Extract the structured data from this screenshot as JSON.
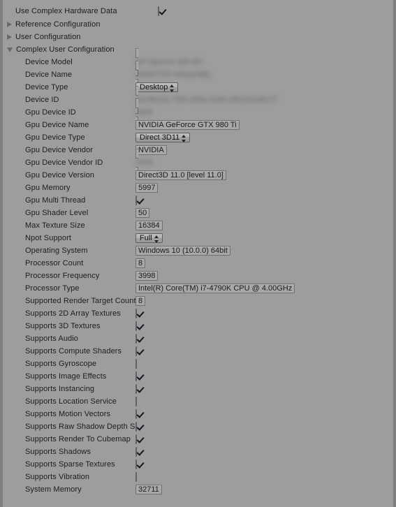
{
  "header": {
    "toggle_label": "Use Complex Hardware Data",
    "toggle_checked": true
  },
  "foldouts": [
    {
      "label": "Reference Configuration",
      "expanded": false
    },
    {
      "label": "User Configuration",
      "expanded": false
    },
    {
      "label": "Complex User Configuration",
      "expanded": true
    }
  ],
  "fields": [
    {
      "label": "Device Model",
      "type": "text",
      "value": "HP Spectre 360 M2",
      "redacted": true
    },
    {
      "label": "Device Name",
      "type": "text",
      "value": "DESKTOP-MVQ4J8Q",
      "redacted": true
    },
    {
      "label": "Device Type",
      "type": "dropdown",
      "value": "Desktop"
    },
    {
      "label": "Device ID",
      "type": "text",
      "value": "a3c9b21e-7f04-4d3a-91bb-ef0c2d1a5e77",
      "redacted": true
    },
    {
      "label": "Gpu Device ID",
      "type": "text",
      "value": "6020",
      "redacted": true
    },
    {
      "label": "Gpu Device Name",
      "type": "text",
      "value": "NVIDIA GeForce GTX 980 Ti"
    },
    {
      "label": "Gpu Device Type",
      "type": "dropdown",
      "value": "Direct 3D11"
    },
    {
      "label": "Gpu Device Vendor",
      "type": "text",
      "value": "NVIDIA"
    },
    {
      "label": "Gpu Device Vendor ID",
      "type": "text",
      "value": "4318",
      "redacted": true
    },
    {
      "label": "Gpu Device Version",
      "type": "text",
      "value": "Direct3D 11.0 [level 11.0]"
    },
    {
      "label": "Gpu Memory",
      "type": "text",
      "value": "5997"
    },
    {
      "label": "Gpu Multi Thread",
      "type": "checkbox",
      "checked": true
    },
    {
      "label": "Gpu Shader Level",
      "type": "text",
      "value": "50"
    },
    {
      "label": "Max Texture Size",
      "type": "text",
      "value": "16384"
    },
    {
      "label": "Npot Support",
      "type": "dropdown",
      "value": "Full"
    },
    {
      "label": "Operating System",
      "type": "text",
      "value": "Windows 10  (10.0.0) 64bit"
    },
    {
      "label": "Processor Count",
      "type": "text",
      "value": "8"
    },
    {
      "label": "Processor Frequency",
      "type": "text",
      "value": "3998"
    },
    {
      "label": "Processor Type",
      "type": "text",
      "value": "Intel(R) Core(TM) i7-4790K CPU @ 4.00GHz"
    },
    {
      "label": "Supported Render Target Count",
      "type": "text",
      "value": "8"
    },
    {
      "label": "Supports 2D Array Textures",
      "type": "checkbox",
      "checked": true
    },
    {
      "label": "Supports 3D Textures",
      "type": "checkbox",
      "checked": true
    },
    {
      "label": "Supports Audio",
      "type": "checkbox",
      "checked": true
    },
    {
      "label": "Supports Compute Shaders",
      "type": "checkbox",
      "checked": true
    },
    {
      "label": "Supports Gyroscope",
      "type": "checkbox",
      "checked": false
    },
    {
      "label": "Supports Image Effects",
      "type": "checkbox",
      "checked": true
    },
    {
      "label": "Supports Instancing",
      "type": "checkbox",
      "checked": true
    },
    {
      "label": "Supports Location Service",
      "type": "checkbox",
      "checked": false
    },
    {
      "label": "Supports Motion Vectors",
      "type": "checkbox",
      "checked": true
    },
    {
      "label": "Supports Raw Shadow Depth Sampling",
      "type": "checkbox",
      "checked": true
    },
    {
      "label": "Supports Render To Cubemap",
      "type": "checkbox",
      "checked": true
    },
    {
      "label": "Supports Shadows",
      "type": "checkbox",
      "checked": true
    },
    {
      "label": "Supports Sparse Textures",
      "type": "checkbox",
      "checked": true
    },
    {
      "label": "Supports Vibration",
      "type": "checkbox",
      "checked": false
    },
    {
      "label": "System Memory",
      "type": "text",
      "value": "32711"
    }
  ],
  "colors": {
    "background": "#9d9d9d",
    "field_fill": "#a8a8a8",
    "field_border": "#6f6f6f",
    "checkbox_on": "#8c9cbb",
    "text": "#1b1b1b"
  }
}
